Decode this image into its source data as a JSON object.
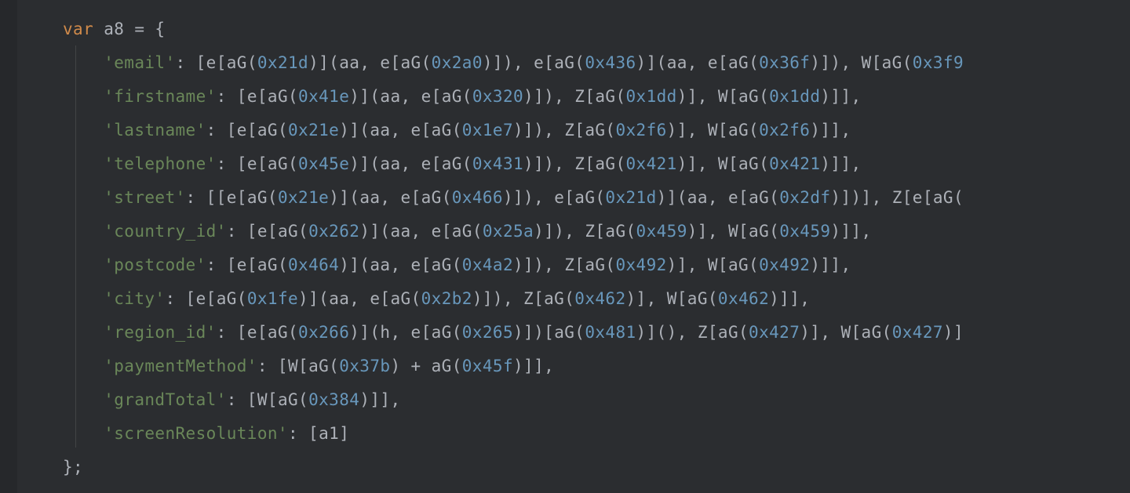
{
  "code": {
    "kw_var": "var",
    "varname": "a8",
    "keys": {
      "email": "'email'",
      "firstname": "'firstname'",
      "lastname": "'lastname'",
      "telephone": "'telephone'",
      "street": "'street'",
      "country_id": "'country_id'",
      "postcode": "'postcode'",
      "city": "'city'",
      "region_id": "'region_id'",
      "paymentMethod": "'paymentMethod'",
      "grandTotal": "'grandTotal'",
      "screenResolution": "'screenResolution'"
    },
    "ids": {
      "e": "e",
      "aG": "aG",
      "aa": "aa",
      "Z": "Z",
      "W": "W",
      "h": "h",
      "a1": "a1"
    },
    "hex": {
      "x21d": "0x21d",
      "x2a0": "0x2a0",
      "x436": "0x436",
      "x36f": "0x36f",
      "x3f9": "0x3f9",
      "x41e": "0x41e",
      "x320": "0x320",
      "x1dd": "0x1dd",
      "x21e": "0x21e",
      "x1e7": "0x1e7",
      "x2f6": "0x2f6",
      "x45e": "0x45e",
      "x431": "0x431",
      "x421": "0x421",
      "x466": "0x466",
      "x2df": "0x2df",
      "x262": "0x262",
      "x25a": "0x25a",
      "x459": "0x459",
      "x464": "0x464",
      "x4a2": "0x4a2",
      "x492": "0x492",
      "x1fe": "0x1fe",
      "x2b2": "0x2b2",
      "x462": "0x462",
      "x266": "0x266",
      "x265": "0x265",
      "x481": "0x481",
      "x427": "0x427",
      "x37b": "0x37b",
      "x45f": "0x45f",
      "x384": "0x384"
    }
  }
}
